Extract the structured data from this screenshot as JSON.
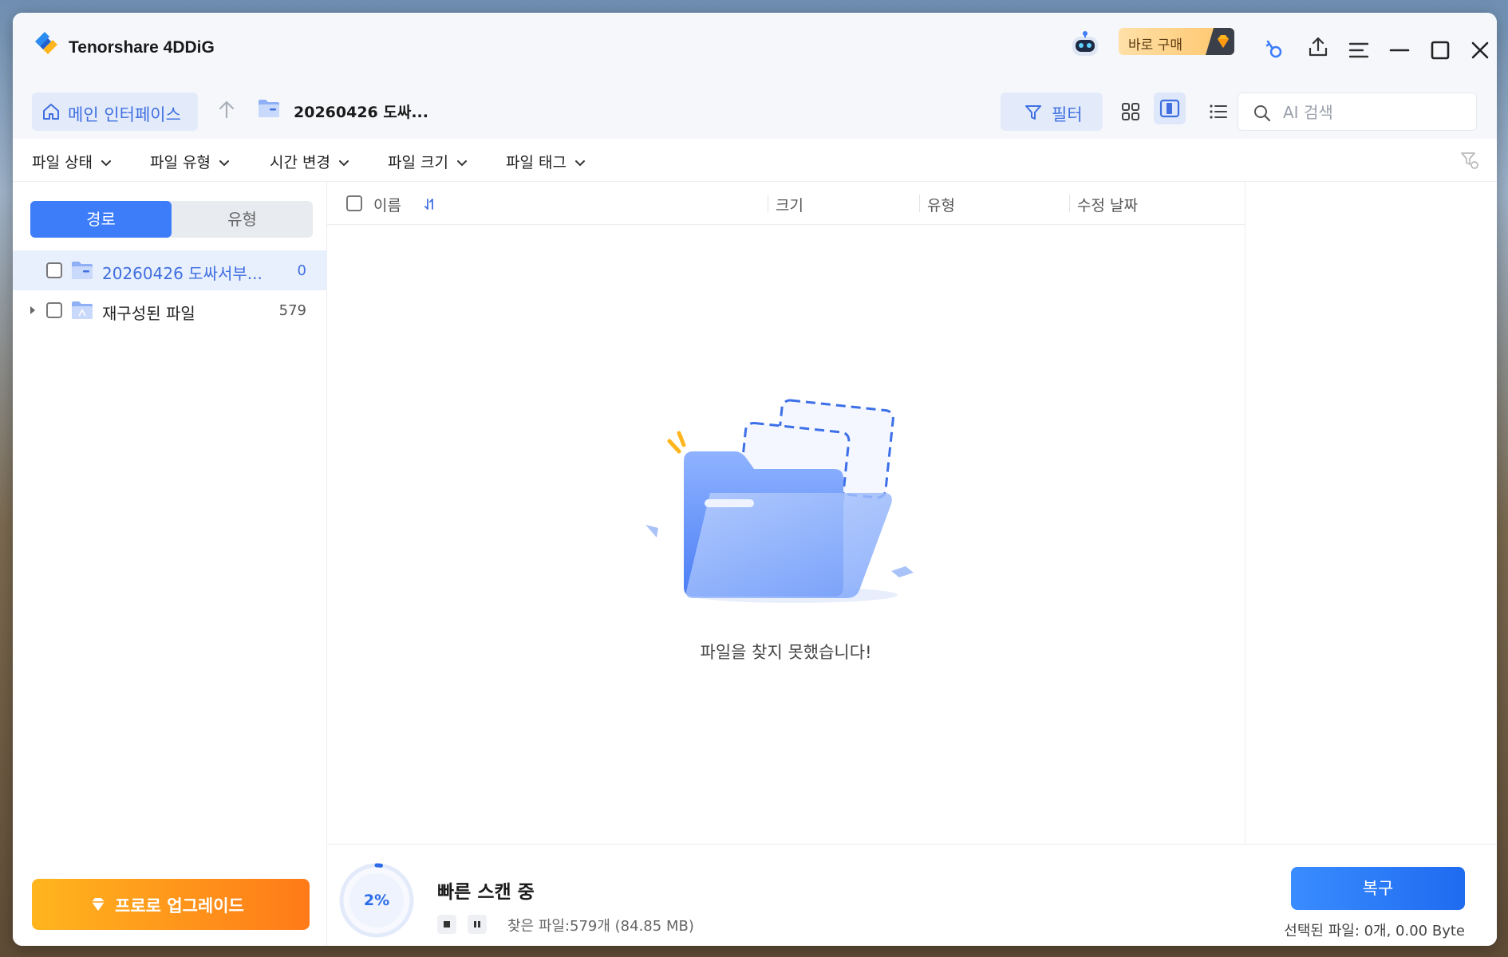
{
  "app": {
    "title": "Tenorshare 4DDiG",
    "buy_label": "바로 구매"
  },
  "toolbar": {
    "home_label": "메인 인터페이스",
    "breadcrumb": "20260426 도싸...",
    "filter_label": "필터",
    "search_placeholder": "AI 검색"
  },
  "filters": [
    {
      "label": "파일 상태"
    },
    {
      "label": "파일 유형"
    },
    {
      "label": "시간 변경"
    },
    {
      "label": "파일 크기"
    },
    {
      "label": "파일 태그"
    }
  ],
  "sidebar": {
    "tabs": [
      {
        "label": "경로",
        "active": true
      },
      {
        "label": "유형",
        "active": false
      }
    ],
    "items": [
      {
        "label": "20260426 도싸서부...",
        "count": "0",
        "selected": true
      },
      {
        "label": "재구성된 파일",
        "count": "579",
        "selected": false
      }
    ],
    "upgrade_label": "프로로 업그레이드"
  },
  "table": {
    "columns": [
      "이름",
      "크기",
      "유형",
      "수정 날짜"
    ],
    "empty_message": "파일을 찾지 못했습니다!"
  },
  "status": {
    "progress_percent": 2,
    "progress_label": "2%",
    "scan_title": "빠른 스캔 중",
    "found_text": "찾은 파일:579개 (84.85 MB)",
    "recover_label": "복구",
    "selected_text": "선택된 파일: 0개, 0.00 Byte"
  },
  "colors": {
    "accent": "#3d7dfa",
    "upgrade_start": "#ffb51e",
    "upgrade_end": "#ff7a18"
  }
}
